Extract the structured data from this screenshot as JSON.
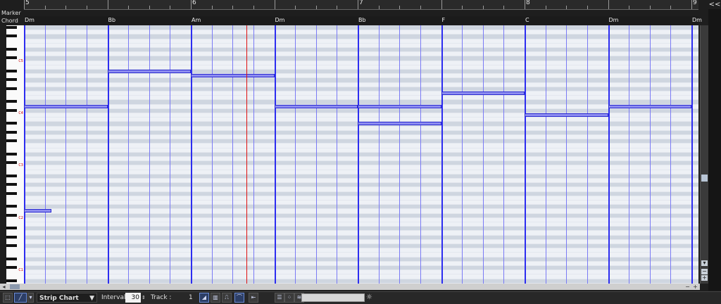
{
  "ruler": {
    "marks": [
      "5",
      "6",
      "7",
      "8",
      "9"
    ]
  },
  "lanes": {
    "marker_label": "Marker",
    "chord_label": "Chord"
  },
  "chords": [
    "Dm",
    "Bb",
    "Am",
    "Dm",
    "Bb",
    "F",
    "C",
    "Dm",
    "Dm"
  ],
  "keyboard": {
    "octave_labels": [
      "C5",
      "C4",
      "C3",
      "C2",
      "C1"
    ]
  },
  "notes": [
    {
      "bar": 5.0,
      "length_bars": 1.0,
      "pitch": "D4"
    },
    {
      "bar": 5.0,
      "length_bars": 0.33,
      "pitch": "D2"
    },
    {
      "bar": 6.0,
      "length_bars": 1.0,
      "pitch": "Bb4"
    },
    {
      "bar": 7.0,
      "length_bars": 1.0,
      "pitch": "A4"
    },
    {
      "bar": 8.0,
      "length_bars": 1.0,
      "pitch": "D4"
    },
    {
      "bar": 9.0,
      "length_bars": 1.0,
      "pitch": "D4"
    },
    {
      "bar": 9.0,
      "length_bars": 1.0,
      "pitch": "Bb3"
    },
    {
      "bar": 10.0,
      "length_bars": 1.0,
      "pitch": "F4"
    },
    {
      "bar": 11.0,
      "length_bars": 1.0,
      "pitch": "C4"
    },
    {
      "bar": 12.0,
      "length_bars": 1.0,
      "pitch": "D4"
    }
  ],
  "playhead_bar": 7.67,
  "toolbar": {
    "mode": "Strip Chart",
    "interval_label": "Interval",
    "interval_value": "30",
    "track_label": "Track :",
    "track_value": "1"
  },
  "colors": {
    "note_fill": "#8d8df0",
    "note_border": "#2a2ad0",
    "bar_line": "#2d2df0",
    "beat_line": "#7a7af5",
    "playhead": "#e01010"
  }
}
